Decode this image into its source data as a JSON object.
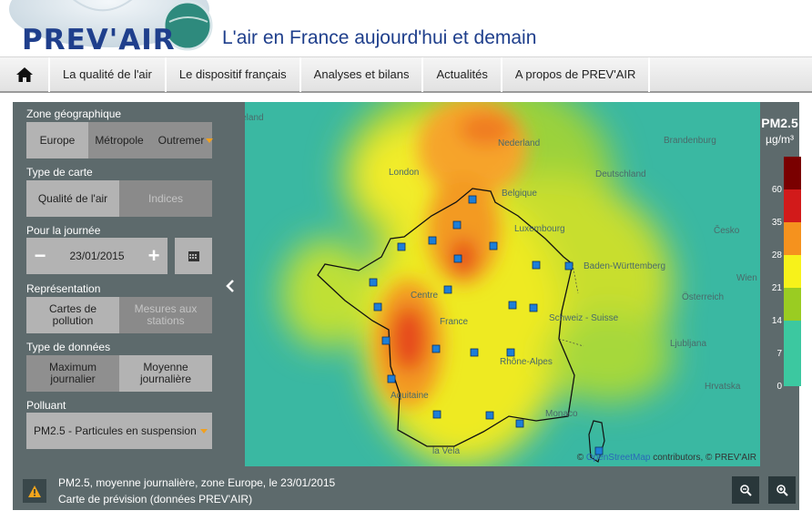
{
  "header": {
    "logo_text": "PREV'AIR",
    "title": "L'air en France aujourd'hui et demain"
  },
  "nav": {
    "home_icon": "home-icon",
    "items": [
      "La qualité de l'air",
      "Le dispositif français",
      "Analyses et bilans",
      "Actualités",
      "A propos de PREV'AIR"
    ]
  },
  "sidebar": {
    "zone_label": "Zone géographique",
    "zone_options": [
      "Europe",
      "Métropole",
      "Outremer"
    ],
    "zone_selected": "Europe",
    "map_type_label": "Type de carte",
    "map_type_options": [
      "Qualité de l'air",
      "Indices"
    ],
    "day_label": "Pour la journée",
    "date_value": "23/01/2015",
    "date_minus": "−",
    "date_plus": "+",
    "repr_label": "Représentation",
    "repr_options": [
      "Cartes de pollution",
      "Mesures aux stations"
    ],
    "data_type_label": "Type de données",
    "data_type_options": [
      "Maximum journalier",
      "Moyenne journalière"
    ],
    "pollutant_label": "Polluant",
    "pollutant_value": "PM2.5 - Particules en suspension"
  },
  "map": {
    "attribution_prefix": "© ",
    "attribution_link": "OpenStreetMap",
    "attribution_suffix": " contributors, © PREV'AIR",
    "place_labels": [
      "Ireland",
      "Nederland",
      "London",
      "Brandenburg",
      "Deutschland",
      "Belgique",
      "Luxembourg",
      "Česko",
      "Baden-Württemberg",
      "Wien",
      "Österreich",
      "Schweiz - Suisse",
      "Ljubljana",
      "Hrvatska",
      "Monaco",
      "France",
      "Centre",
      "Aquitaine",
      "Rhône-Alpes",
      "la Vela"
    ]
  },
  "legend": {
    "title": "PM2.5",
    "unit": "µg/m³",
    "ticks": [
      "60",
      "35",
      "28",
      "21",
      "14",
      "7",
      "0"
    ],
    "colors": [
      "#7a0000",
      "#d21a1a",
      "#f5921e",
      "#f7f21a",
      "#9acc22",
      "#3cc8a0",
      "#3cc8a0"
    ]
  },
  "footer": {
    "line1": "PM2.5, moyenne journalière, zone Europe, le 23/01/2015",
    "line2": "Carte de prévision (données PREV'AIR)",
    "warning_icon": "warning-icon",
    "zoom_out_icon": "zoom-out-icon",
    "zoom_in_icon": "zoom-in-icon"
  }
}
